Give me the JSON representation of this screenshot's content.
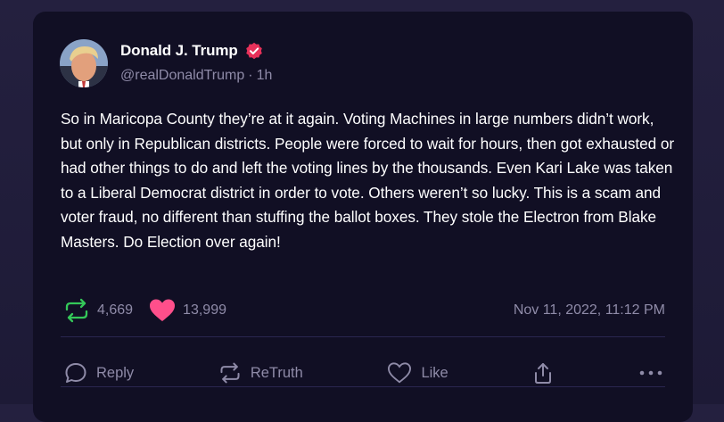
{
  "post": {
    "author_name": "Donald J. Trump",
    "handle": "@realDonaldTrump",
    "separator": "·",
    "age": "1h",
    "text": "So in Maricopa County they’re at it again. Voting Machines in large numbers didn’t work, but only in Republican districts. People were forced to wait for hours, then got exhausted or had other things to do and left the voting lines by the thousands. Even Kari Lake was taken to a Liberal Democrat district in order to vote. Others weren’t so lucky. This is a scam and voter fraud, no different than stuffing the ballot boxes. They stole the Electron from Blake Masters. Do Election over again!",
    "retruth_count": "4,669",
    "like_count": "13,999",
    "timestamp": "Nov 11, 2022, 11:12 PM"
  },
  "actions": {
    "reply_label": "Reply",
    "retruth_label": "ReTruth",
    "like_label": "Like"
  },
  "colors": {
    "page_bg": "#1d1a36",
    "card_bg": "#110f24",
    "muted_text": "#8f8ba8",
    "retruth_green": "#34c759",
    "like_pink": "#ff4f8b",
    "verified_badge": "#e8315a"
  },
  "icons": {
    "verified": "verified-badge-icon",
    "retruth_stat": "retruth-icon",
    "like_stat": "heart-filled-icon",
    "reply": "reply-bubble-icon",
    "retruth_action": "retruth-icon",
    "like_action": "heart-outline-icon",
    "share": "share-icon",
    "more": "more-dots-icon"
  }
}
